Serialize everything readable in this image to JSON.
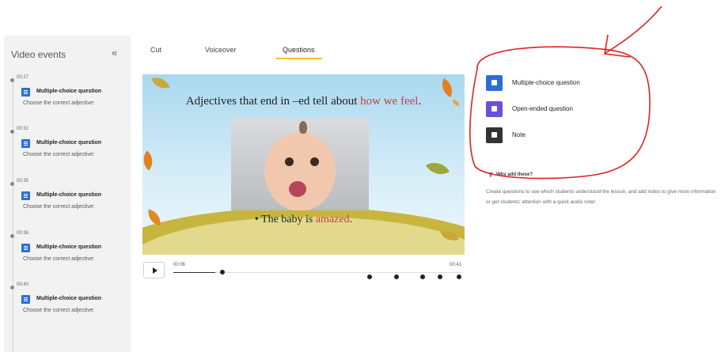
{
  "sidebar": {
    "title": "Video events",
    "collapse_icon": "double-chevron-left-icon",
    "events": [
      {
        "time": "00:27",
        "type": "Multiple-choice question",
        "description": "Choose the correct adjective:"
      },
      {
        "time": "00:31",
        "type": "Multiple-choice question",
        "description": "Choose the correct adjective:"
      },
      {
        "time": "00:35",
        "type": "Multiple-choice question",
        "description": "Choose the correct adjective:"
      },
      {
        "time": "00:38",
        "type": "Multiple-choice question",
        "description": "Choose the correct adjective:"
      },
      {
        "time": "00:40",
        "type": "Multiple-choice question",
        "description": "Choose the correct adjective:"
      }
    ]
  },
  "tabs": [
    {
      "label": "Cut"
    },
    {
      "label": "Voiceover"
    },
    {
      "label": "Questions",
      "active": true
    }
  ],
  "slide": {
    "title_prefix": "Adjectives that end in –ed tell about ",
    "title_highlight": "how we feel",
    "title_suffix": ".",
    "caption_prefix": "• The baby is ",
    "caption_highlight": "amazed",
    "caption_suffix": "."
  },
  "player": {
    "current_time": "00:06",
    "end_time": "00:41",
    "progress_fraction": 0.146,
    "play_icon": "play-icon"
  },
  "add_options": [
    {
      "label": "Multiple-choice question",
      "icon": "list-icon",
      "color": "#2a6fd6"
    },
    {
      "label": "Open-ended question",
      "icon": "speech-bubble-icon",
      "color": "#6d4fd8"
    },
    {
      "label": "Note",
      "icon": "note-icon",
      "color": "#333333"
    }
  ],
  "why": {
    "label": "Why add these?",
    "text": "Create questions to see which students understood the lesson, and add notes to give more information or get students' attention with a quick audio note!"
  },
  "colors": {
    "accent_underline": "#f0c419",
    "annotation": "#e02020",
    "highlight_text": "#d23b3b"
  }
}
